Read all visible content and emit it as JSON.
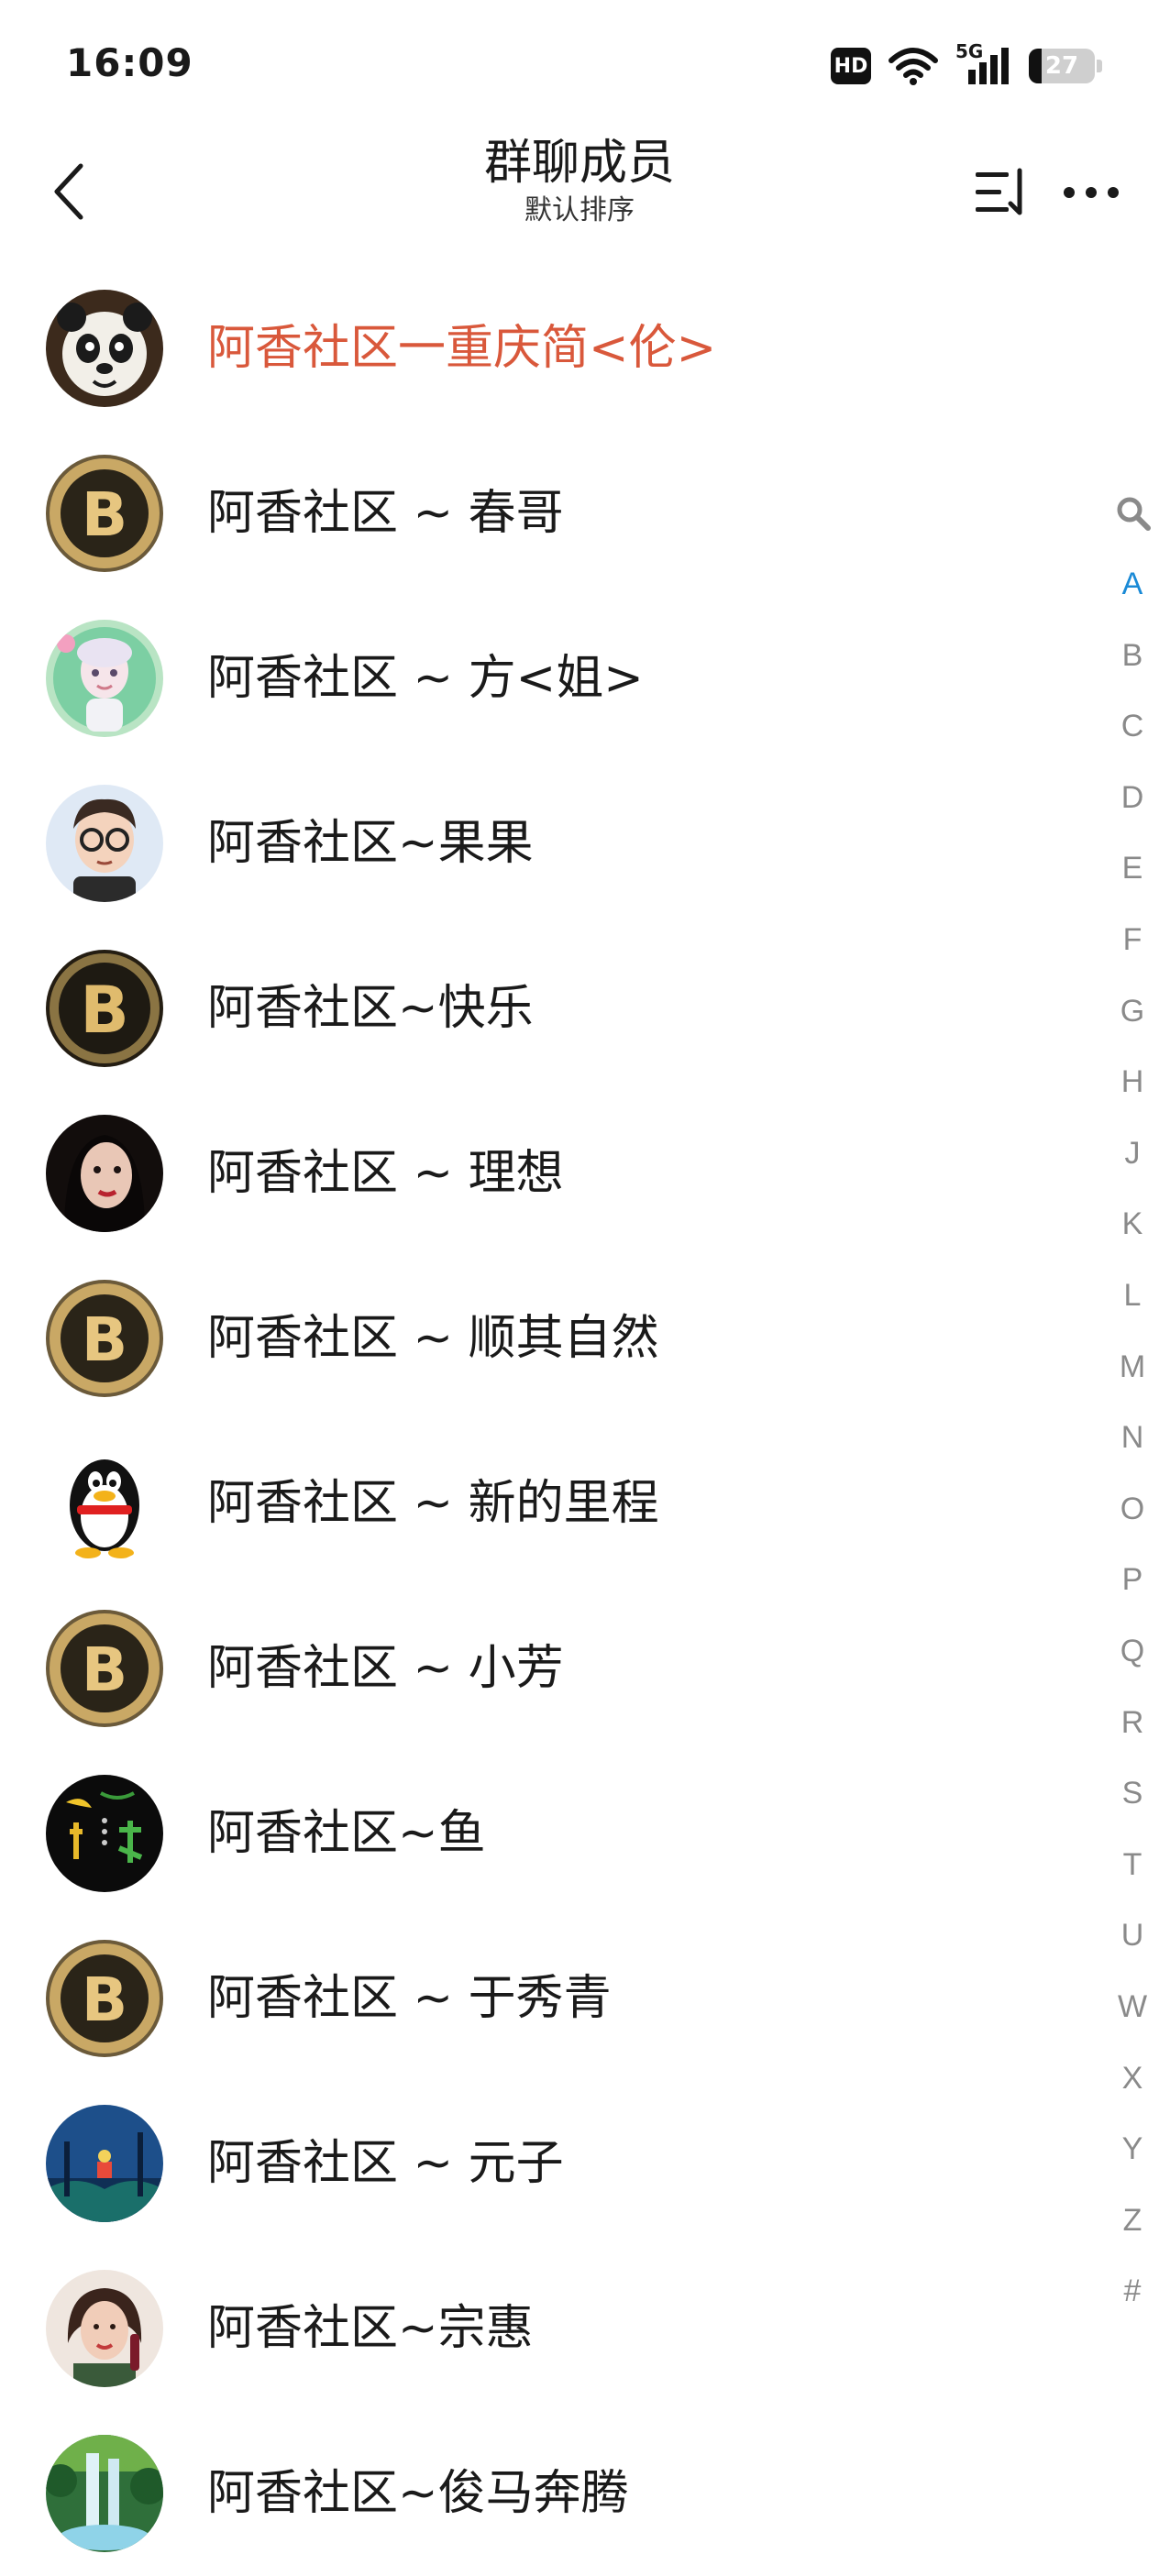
{
  "status_bar": {
    "time": "16:09",
    "network": "5G",
    "hd_label": "HD",
    "battery_level": "27"
  },
  "header": {
    "title": "群聊成员",
    "subtitle": "默认排序"
  },
  "members": [
    {
      "name": "阿香社区一重庆简<伦>",
      "highlight": true,
      "avatar": "panda"
    },
    {
      "name": "阿香社区 ~ 春哥",
      "avatar": "gold-coin"
    },
    {
      "name": "阿香社区 ~ 方<姐>",
      "avatar": "girl-cartoon"
    },
    {
      "name": "阿香社区~果果",
      "avatar": "boy-cartoon"
    },
    {
      "name": "阿香社区~快乐",
      "avatar": "gold-coin-dark"
    },
    {
      "name": "阿香社区 ~ 理想",
      "avatar": "woman-portrait"
    },
    {
      "name": "阿香社区 ~ 顺其自然",
      "avatar": "gold-coin"
    },
    {
      "name": "阿香社区 ~ 新的里程",
      "avatar": "penguin"
    },
    {
      "name": "阿香社区 ~ 小芳",
      "avatar": "gold-coin"
    },
    {
      "name": "阿香社区~鱼",
      "avatar": "dark-calligraphy"
    },
    {
      "name": "阿香社区 ~ 于秀青",
      "avatar": "gold-coin"
    },
    {
      "name": "阿香社区 ~ 元子",
      "avatar": "night-scene"
    },
    {
      "name": "阿香社区~宗惠",
      "avatar": "woman-portrait-2"
    },
    {
      "name": "阿香社区~俊马奔腾",
      "avatar": "waterfall"
    }
  ],
  "alphabet_index": {
    "active": "A",
    "letters": [
      "A",
      "B",
      "C",
      "D",
      "E",
      "F",
      "G",
      "H",
      "J",
      "K",
      "L",
      "M",
      "N",
      "O",
      "P",
      "Q",
      "R",
      "S",
      "T",
      "U",
      "W",
      "X",
      "Y",
      "Z",
      "#"
    ]
  },
  "colors": {
    "highlight": "#d9583b",
    "index_active": "#1a8ad6",
    "index_text": "#8a8a8a"
  }
}
